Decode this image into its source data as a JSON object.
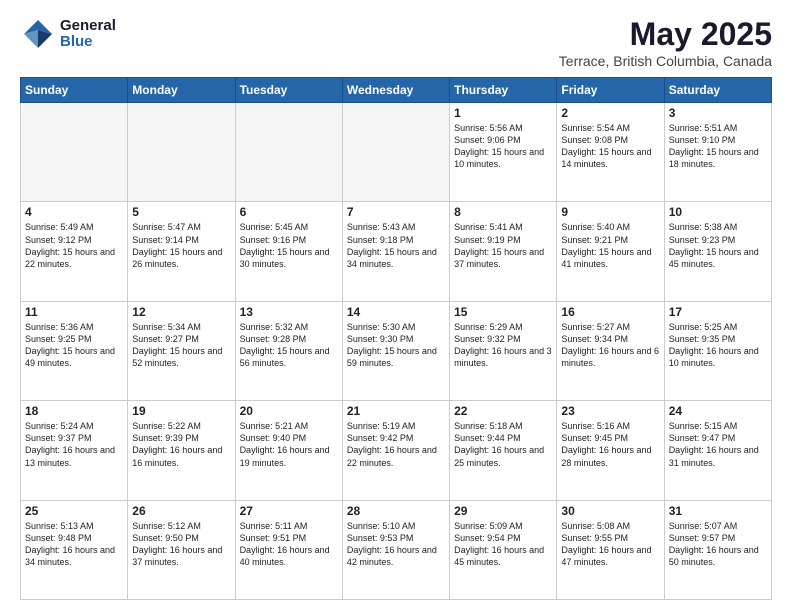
{
  "header": {
    "logo": {
      "general": "General",
      "blue": "Blue"
    },
    "title": "May 2025",
    "location": "Terrace, British Columbia, Canada"
  },
  "weekdays": [
    "Sunday",
    "Monday",
    "Tuesday",
    "Wednesday",
    "Thursday",
    "Friday",
    "Saturday"
  ],
  "weeks": [
    [
      {
        "day": "",
        "info": "",
        "empty": true
      },
      {
        "day": "",
        "info": "",
        "empty": true
      },
      {
        "day": "",
        "info": "",
        "empty": true
      },
      {
        "day": "",
        "info": "",
        "empty": true
      },
      {
        "day": "1",
        "info": "Sunrise: 5:56 AM\nSunset: 9:06 PM\nDaylight: 15 hours\nand 10 minutes."
      },
      {
        "day": "2",
        "info": "Sunrise: 5:54 AM\nSunset: 9:08 PM\nDaylight: 15 hours\nand 14 minutes."
      },
      {
        "day": "3",
        "info": "Sunrise: 5:51 AM\nSunset: 9:10 PM\nDaylight: 15 hours\nand 18 minutes."
      }
    ],
    [
      {
        "day": "4",
        "info": "Sunrise: 5:49 AM\nSunset: 9:12 PM\nDaylight: 15 hours\nand 22 minutes."
      },
      {
        "day": "5",
        "info": "Sunrise: 5:47 AM\nSunset: 9:14 PM\nDaylight: 15 hours\nand 26 minutes."
      },
      {
        "day": "6",
        "info": "Sunrise: 5:45 AM\nSunset: 9:16 PM\nDaylight: 15 hours\nand 30 minutes."
      },
      {
        "day": "7",
        "info": "Sunrise: 5:43 AM\nSunset: 9:18 PM\nDaylight: 15 hours\nand 34 minutes."
      },
      {
        "day": "8",
        "info": "Sunrise: 5:41 AM\nSunset: 9:19 PM\nDaylight: 15 hours\nand 37 minutes."
      },
      {
        "day": "9",
        "info": "Sunrise: 5:40 AM\nSunset: 9:21 PM\nDaylight: 15 hours\nand 41 minutes."
      },
      {
        "day": "10",
        "info": "Sunrise: 5:38 AM\nSunset: 9:23 PM\nDaylight: 15 hours\nand 45 minutes."
      }
    ],
    [
      {
        "day": "11",
        "info": "Sunrise: 5:36 AM\nSunset: 9:25 PM\nDaylight: 15 hours\nand 49 minutes."
      },
      {
        "day": "12",
        "info": "Sunrise: 5:34 AM\nSunset: 9:27 PM\nDaylight: 15 hours\nand 52 minutes."
      },
      {
        "day": "13",
        "info": "Sunrise: 5:32 AM\nSunset: 9:28 PM\nDaylight: 15 hours\nand 56 minutes."
      },
      {
        "day": "14",
        "info": "Sunrise: 5:30 AM\nSunset: 9:30 PM\nDaylight: 15 hours\nand 59 minutes."
      },
      {
        "day": "15",
        "info": "Sunrise: 5:29 AM\nSunset: 9:32 PM\nDaylight: 16 hours\nand 3 minutes."
      },
      {
        "day": "16",
        "info": "Sunrise: 5:27 AM\nSunset: 9:34 PM\nDaylight: 16 hours\nand 6 minutes."
      },
      {
        "day": "17",
        "info": "Sunrise: 5:25 AM\nSunset: 9:35 PM\nDaylight: 16 hours\nand 10 minutes."
      }
    ],
    [
      {
        "day": "18",
        "info": "Sunrise: 5:24 AM\nSunset: 9:37 PM\nDaylight: 16 hours\nand 13 minutes."
      },
      {
        "day": "19",
        "info": "Sunrise: 5:22 AM\nSunset: 9:39 PM\nDaylight: 16 hours\nand 16 minutes."
      },
      {
        "day": "20",
        "info": "Sunrise: 5:21 AM\nSunset: 9:40 PM\nDaylight: 16 hours\nand 19 minutes."
      },
      {
        "day": "21",
        "info": "Sunrise: 5:19 AM\nSunset: 9:42 PM\nDaylight: 16 hours\nand 22 minutes."
      },
      {
        "day": "22",
        "info": "Sunrise: 5:18 AM\nSunset: 9:44 PM\nDaylight: 16 hours\nand 25 minutes."
      },
      {
        "day": "23",
        "info": "Sunrise: 5:16 AM\nSunset: 9:45 PM\nDaylight: 16 hours\nand 28 minutes."
      },
      {
        "day": "24",
        "info": "Sunrise: 5:15 AM\nSunset: 9:47 PM\nDaylight: 16 hours\nand 31 minutes."
      }
    ],
    [
      {
        "day": "25",
        "info": "Sunrise: 5:13 AM\nSunset: 9:48 PM\nDaylight: 16 hours\nand 34 minutes."
      },
      {
        "day": "26",
        "info": "Sunrise: 5:12 AM\nSunset: 9:50 PM\nDaylight: 16 hours\nand 37 minutes."
      },
      {
        "day": "27",
        "info": "Sunrise: 5:11 AM\nSunset: 9:51 PM\nDaylight: 16 hours\nand 40 minutes."
      },
      {
        "day": "28",
        "info": "Sunrise: 5:10 AM\nSunset: 9:53 PM\nDaylight: 16 hours\nand 42 minutes."
      },
      {
        "day": "29",
        "info": "Sunrise: 5:09 AM\nSunset: 9:54 PM\nDaylight: 16 hours\nand 45 minutes."
      },
      {
        "day": "30",
        "info": "Sunrise: 5:08 AM\nSunset: 9:55 PM\nDaylight: 16 hours\nand 47 minutes."
      },
      {
        "day": "31",
        "info": "Sunrise: 5:07 AM\nSunset: 9:57 PM\nDaylight: 16 hours\nand 50 minutes."
      }
    ]
  ]
}
